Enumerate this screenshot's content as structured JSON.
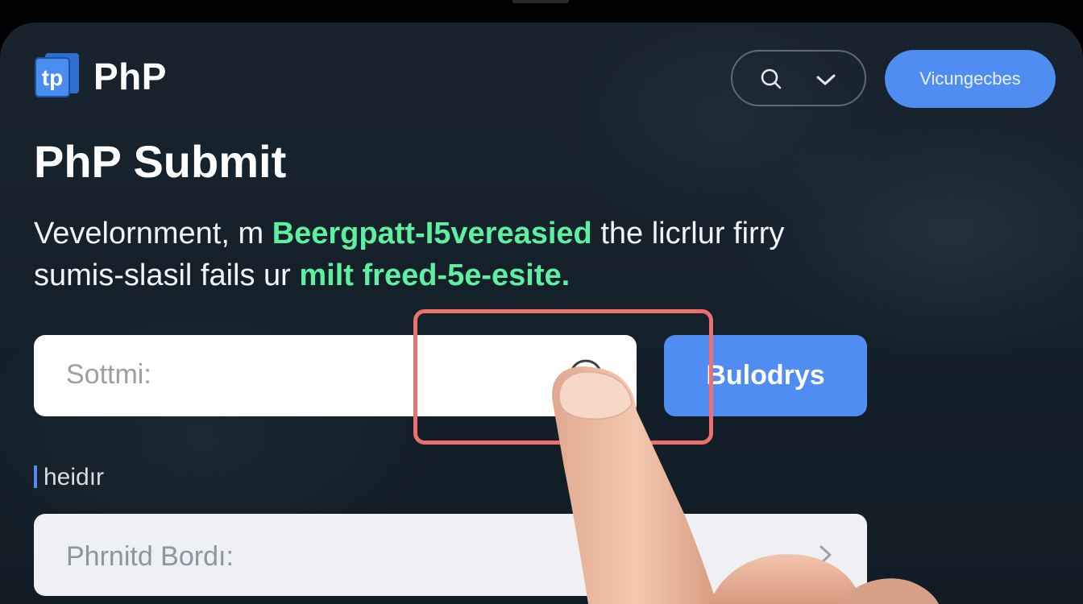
{
  "header": {
    "brand": "PhP",
    "logo_text": "tp",
    "search_icon": "search-icon",
    "check_icon": "check-icon",
    "top_button_label": "Vicungecbes"
  },
  "main": {
    "title": "PhP Submit",
    "description": {
      "line1_a": "Vevelornment, m ",
      "line1_b": "Beergpatt-I5vereasied",
      "line1_c": " the licrlur firry",
      "line2_a": "sumis-slasil fails ur ",
      "line2_b": "milt  freed-5e-esite."
    },
    "primary_input": {
      "placeholder": "Sottmi:",
      "icon": "circle-icon"
    },
    "action_button_label": "Bulodrys",
    "field_label": "heidır",
    "secondary_input": {
      "placeholder": "Phrnitd Bordı:",
      "icon": "chevron-right-icon"
    }
  },
  "colors": {
    "accent": "#4f8df2",
    "highlight_text": "#5ef0a0",
    "focus_box": "#ef6f6c",
    "background": "#14202a"
  }
}
